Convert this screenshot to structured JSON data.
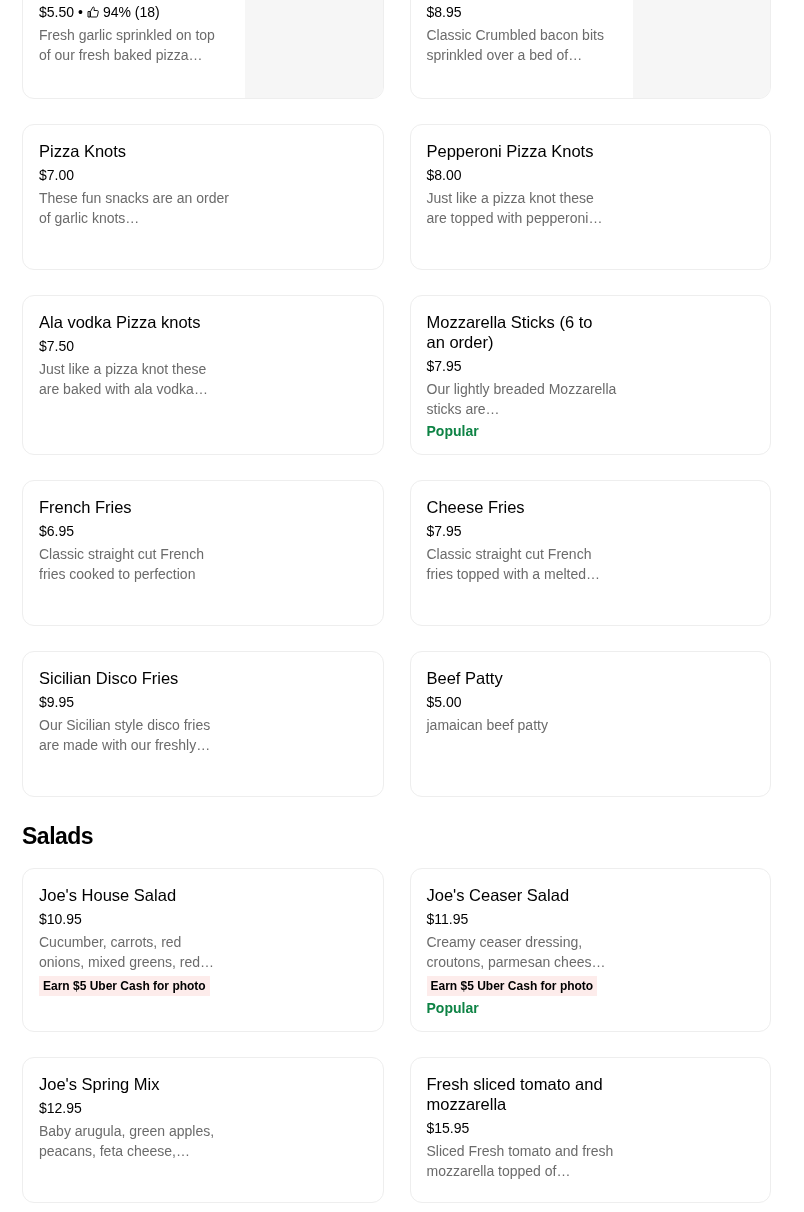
{
  "sections": [
    {
      "items": [
        {
          "price": "$5.50",
          "separator": "•",
          "rating": "94% (18)",
          "description": "Fresh garlic sprinkled on top of our fresh baked pizza…"
        },
        {
          "price": "$8.95",
          "description": "Classic Crumbled bacon bits sprinkled over a bed of…"
        },
        {
          "name": "Pizza Knots",
          "price": "$7.00",
          "description": "These fun snacks are an order of garlic knots…"
        },
        {
          "name": "Pepperoni Pizza Knots",
          "price": "$8.00",
          "description": "Just like a pizza knot these are topped with pepperoni…"
        },
        {
          "name": "Ala vodka Pizza knots",
          "price": "$7.50",
          "description": "Just like a pizza knot these are baked with ala vodka…"
        },
        {
          "name": "Mozzarella Sticks (6 to an order)",
          "price": "$7.95",
          "description": "Our lightly breaded Mozzarella sticks are…",
          "tag": "Popular"
        },
        {
          "name": "French Fries",
          "price": "$6.95",
          "description": "Classic straight cut French fries cooked to perfection"
        },
        {
          "name": "Cheese Fries",
          "price": "$7.95",
          "description": "Classic straight cut French fries topped with a melted…"
        },
        {
          "name": "Sicilian Disco Fries",
          "price": "$9.95",
          "description": "Our Sicilian style disco fries are made with our freshly…"
        },
        {
          "name": "Beef Patty",
          "price": "$5.00",
          "description": "jamaican beef patty"
        }
      ]
    },
    {
      "title": "Salads",
      "items": [
        {
          "name": "Joe's House Salad",
          "price": "$10.95",
          "description": "Cucumber, carrots, red onions, mixed greens, red…",
          "badge": "Earn $5 Uber Cash for photo"
        },
        {
          "name": "Joe's Ceaser Salad",
          "price": "$11.95",
          "description": "Creamy ceaser dressing, croutons, parmesan chees…",
          "badge": "Earn $5 Uber Cash for photo",
          "tag": "Popular"
        },
        {
          "name": "Joe's Spring Mix",
          "price": "$12.95",
          "description": "Baby arugula, green apples, peacans, feta cheese,…"
        },
        {
          "name": "Fresh sliced tomato and mozzarella",
          "price": "$15.95",
          "description": "Sliced Fresh tomato and fresh mozzarella topped of…"
        }
      ]
    }
  ]
}
